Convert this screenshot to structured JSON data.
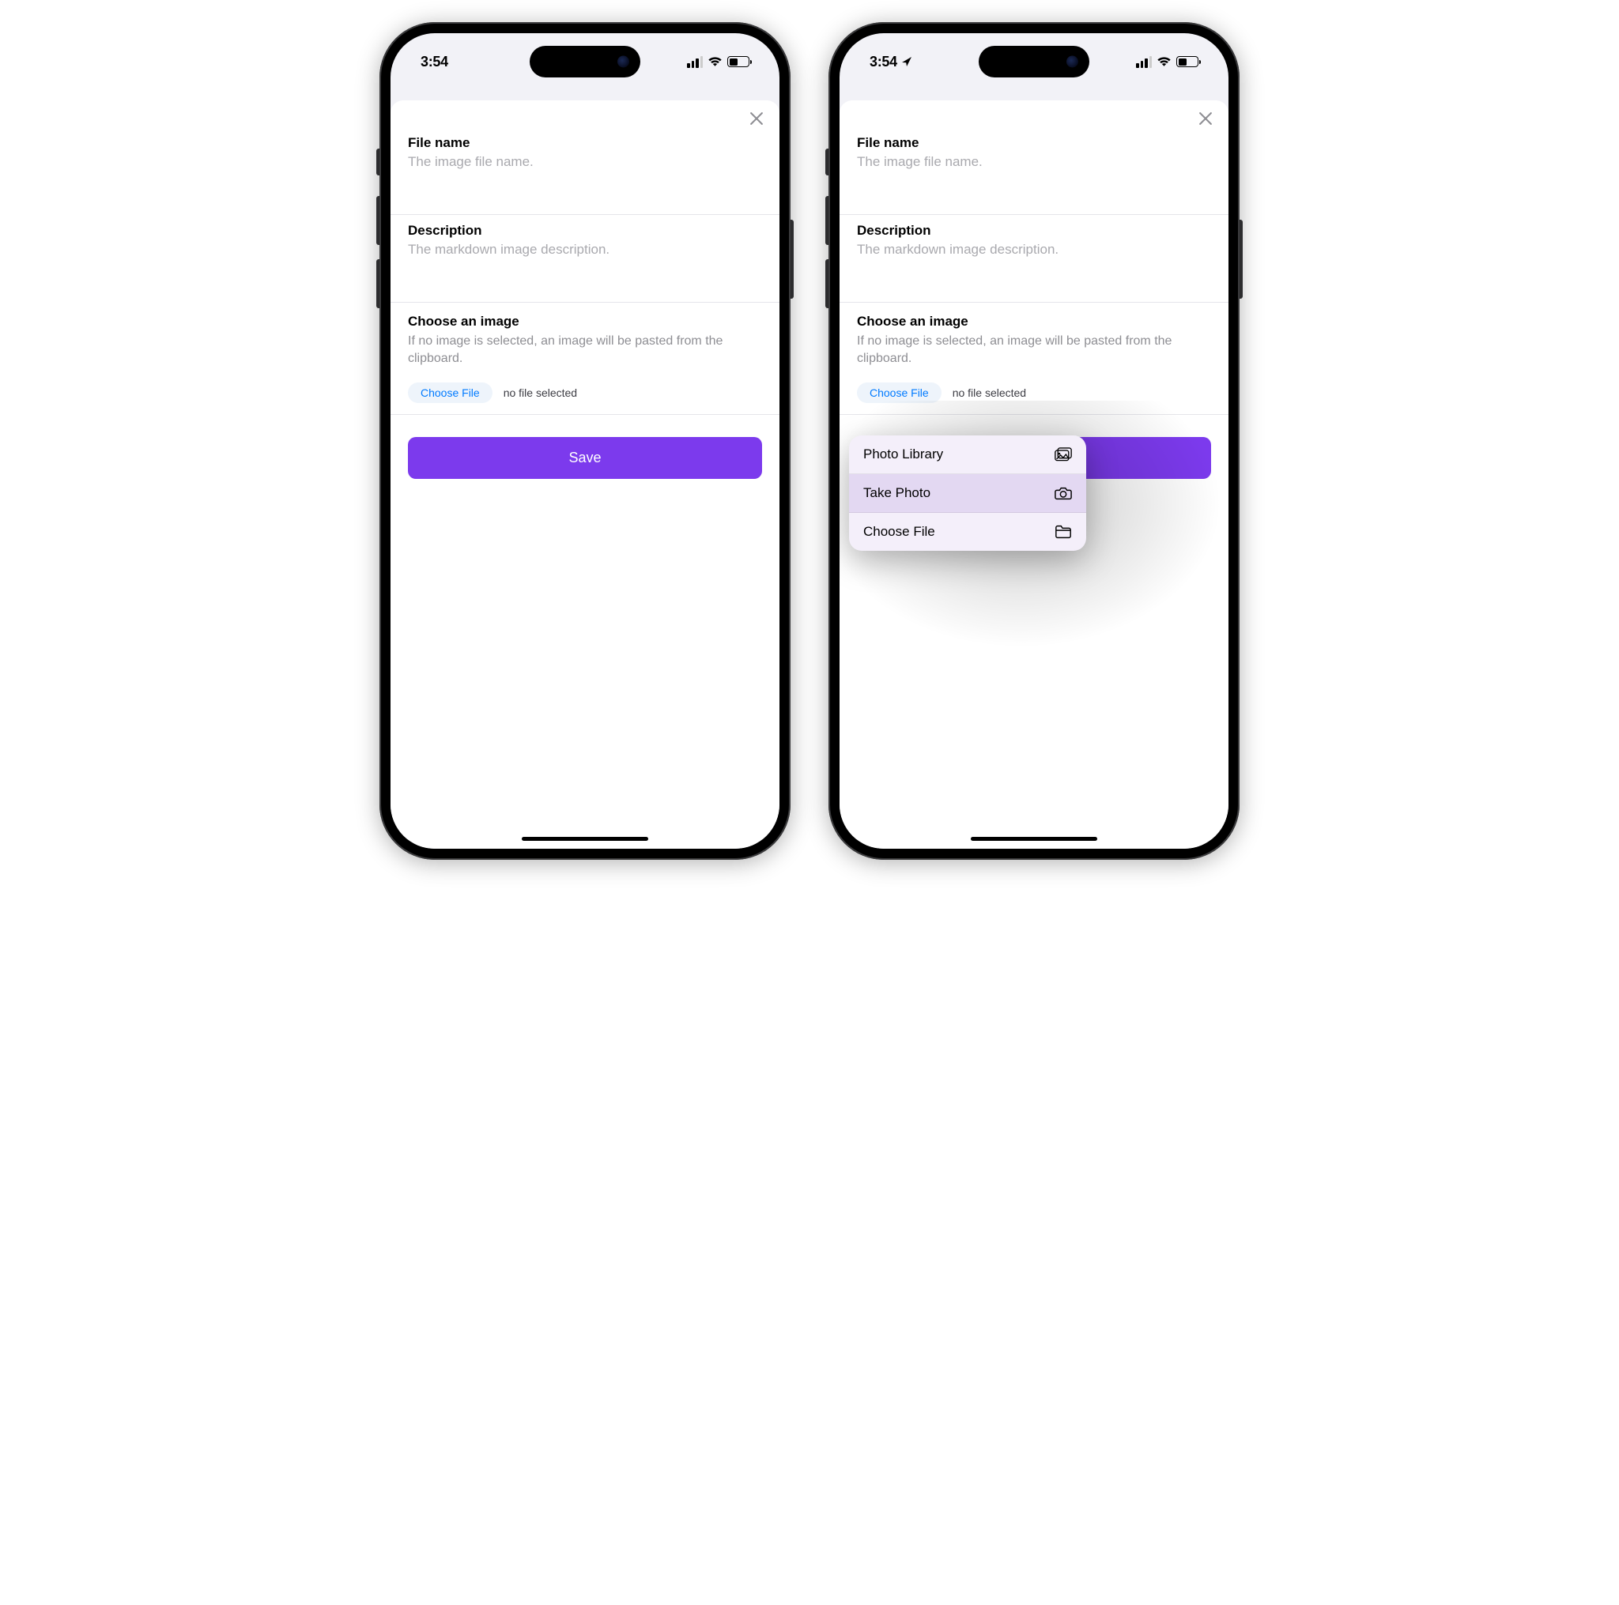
{
  "status": {
    "time_left": "3:54",
    "time_right": "3:54",
    "location_indicator": true
  },
  "modal": {
    "close_icon": "×",
    "fields": {
      "filename": {
        "label": "File name",
        "placeholder": "The image file name.",
        "value": ""
      },
      "description": {
        "label": "Description",
        "placeholder": "The markdown image description.",
        "value": ""
      }
    },
    "choose": {
      "heading": "Choose an image",
      "hint": "If no image is selected, an image will be pasted from the clipboard.",
      "button_label": "Choose File",
      "status_text": "no file selected"
    },
    "save_label": "Save"
  },
  "picker_menu": {
    "items": [
      {
        "label": "Photo Library",
        "icon": "photos-icon",
        "selected": false
      },
      {
        "label": "Take Photo",
        "icon": "camera-icon",
        "selected": true
      },
      {
        "label": "Choose File",
        "icon": "folder-icon",
        "selected": false
      }
    ]
  },
  "colors": {
    "accent": "#7c3aed",
    "link": "#007aff",
    "secondary_text": "#8e8e93"
  }
}
